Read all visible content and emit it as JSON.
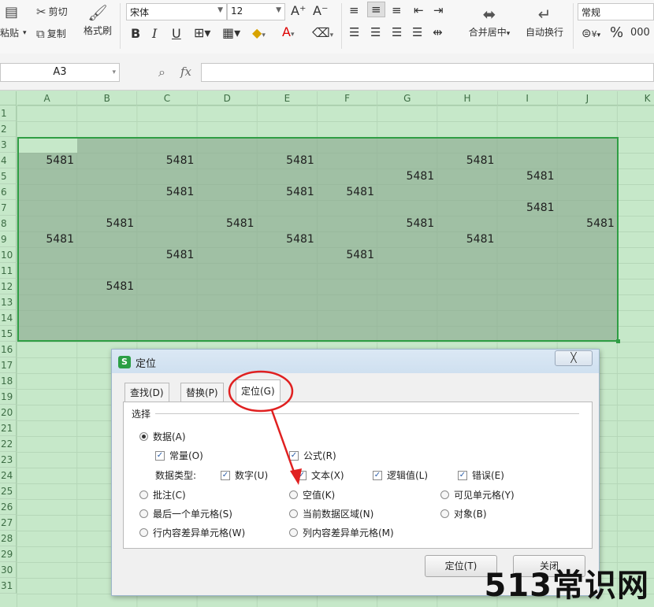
{
  "ribbon": {
    "paste_label": "粘贴",
    "cut_label": "剪切",
    "copy_label": "复制",
    "format_painter_label": "格式刷",
    "font_name": "宋体",
    "font_size": "12",
    "bold": "B",
    "italic": "I",
    "underline": "U",
    "increase_font": "A⁺",
    "decrease_font": "A⁻",
    "merge_center_label": "合并居中",
    "wrap_text_label": "自动换行",
    "number_format": "常规",
    "currency_symbol": "¥",
    "percent_symbol": "%",
    "thousands_symbol": "000"
  },
  "formula_bar": {
    "name_box": "A3",
    "fx_label": "fx",
    "formula": ""
  },
  "sheet": {
    "columns": [
      "A",
      "B",
      "C",
      "D",
      "E",
      "F",
      "G",
      "H",
      "I",
      "J",
      "K"
    ],
    "rows": [
      "1",
      "2",
      "3",
      "4",
      "5",
      "6",
      "7",
      "8",
      "9",
      "10",
      "11",
      "12",
      "13",
      "14",
      "15",
      "16",
      "17",
      "18",
      "19",
      "20",
      "21",
      "22",
      "23",
      "24",
      "25",
      "26",
      "27",
      "28",
      "29",
      "30",
      "31"
    ],
    "cells": [
      {
        "col": "A",
        "row": "4",
        "value": "5481"
      },
      {
        "col": "C",
        "row": "4",
        "value": "5481"
      },
      {
        "col": "E",
        "row": "4",
        "value": "5481"
      },
      {
        "col": "H",
        "row": "4",
        "value": "5481"
      },
      {
        "col": "G",
        "row": "5",
        "value": "5481"
      },
      {
        "col": "I",
        "row": "5",
        "value": "5481"
      },
      {
        "col": "C",
        "row": "6",
        "value": "5481"
      },
      {
        "col": "E",
        "row": "6",
        "value": "5481"
      },
      {
        "col": "F",
        "row": "6",
        "value": "5481"
      },
      {
        "col": "I",
        "row": "7",
        "value": "5481"
      },
      {
        "col": "B",
        "row": "8",
        "value": "5481"
      },
      {
        "col": "D",
        "row": "8",
        "value": "5481"
      },
      {
        "col": "G",
        "row": "8",
        "value": "5481"
      },
      {
        "col": "J",
        "row": "8",
        "value": "5481"
      },
      {
        "col": "A",
        "row": "9",
        "value": "5481"
      },
      {
        "col": "E",
        "row": "9",
        "value": "5481"
      },
      {
        "col": "H",
        "row": "9",
        "value": "5481"
      },
      {
        "col": "C",
        "row": "10",
        "value": "5481"
      },
      {
        "col": "F",
        "row": "10",
        "value": "5481"
      },
      {
        "col": "B",
        "row": "12",
        "value": "5481"
      }
    ]
  },
  "dialog": {
    "title": "定位",
    "close_label": "╳",
    "tabs": [
      {
        "label": "查找(D)",
        "active": false
      },
      {
        "label": "替换(P)",
        "active": false
      },
      {
        "label": "定位(G)",
        "active": true
      }
    ],
    "group_label": "选择",
    "options": {
      "data": "数据(A)",
      "constants": "常量(O)",
      "formulas": "公式(R)",
      "data_type_label": "数据类型:",
      "numbers": "数字(U)",
      "text": "文本(X)",
      "logicals": "逻辑值(L)",
      "errors": "错误(E)",
      "comments": "批注(C)",
      "blanks": "空值(K)",
      "visible_cells": "可见单元格(Y)",
      "last_cell": "最后一个单元格(S)",
      "current_region": "当前数据区域(N)",
      "objects": "对象(B)",
      "row_differences": "行内容差异单元格(W)",
      "column_differences": "列内容差异单元格(M)"
    },
    "locate_button": "定位(T)",
    "close_button": "关闭"
  },
  "watermark": "513常识网",
  "colors": {
    "sheet_bg": "#c6e8c9",
    "selection_border": "#2f9e44",
    "annotation_red": "#e02020"
  }
}
